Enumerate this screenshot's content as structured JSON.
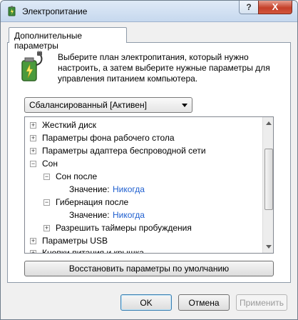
{
  "window": {
    "title": "Электропитание",
    "help_glyph": "?",
    "close_glyph": "X"
  },
  "tab": {
    "label": "Дополнительные параметры"
  },
  "description": "Выберите план электропитания, который нужно настроить, а затем выберите нужные параметры для управления питанием компьютера.",
  "plan_select": {
    "value": "Сбалансированный [Активен]"
  },
  "tree": {
    "items": [
      {
        "label": "Жесткий диск",
        "expander": "+"
      },
      {
        "label": "Параметры фона рабочего стола",
        "expander": "+"
      },
      {
        "label": "Параметры адаптера беспроводной сети",
        "expander": "+"
      },
      {
        "label": "Сон",
        "expander": "−"
      },
      {
        "label": "Сон после",
        "expander": "−"
      },
      {
        "label": "Значение:",
        "value": "Никогда"
      },
      {
        "label": "Гибернация после",
        "expander": "−"
      },
      {
        "label": "Значение:",
        "value": "Никогда"
      },
      {
        "label": "Разрешить таймеры пробуждения",
        "expander": "+"
      },
      {
        "label": "Параметры USB",
        "expander": "+"
      },
      {
        "label": "Кнопки питания и крышка",
        "expander": "+"
      }
    ]
  },
  "buttons": {
    "restore": "Восстановить параметры по умолчанию",
    "ok": "OK",
    "cancel": "Отмена",
    "apply": "Применить"
  },
  "colors": {
    "link": "#1f5fcf",
    "close_red": "#c4402a"
  }
}
